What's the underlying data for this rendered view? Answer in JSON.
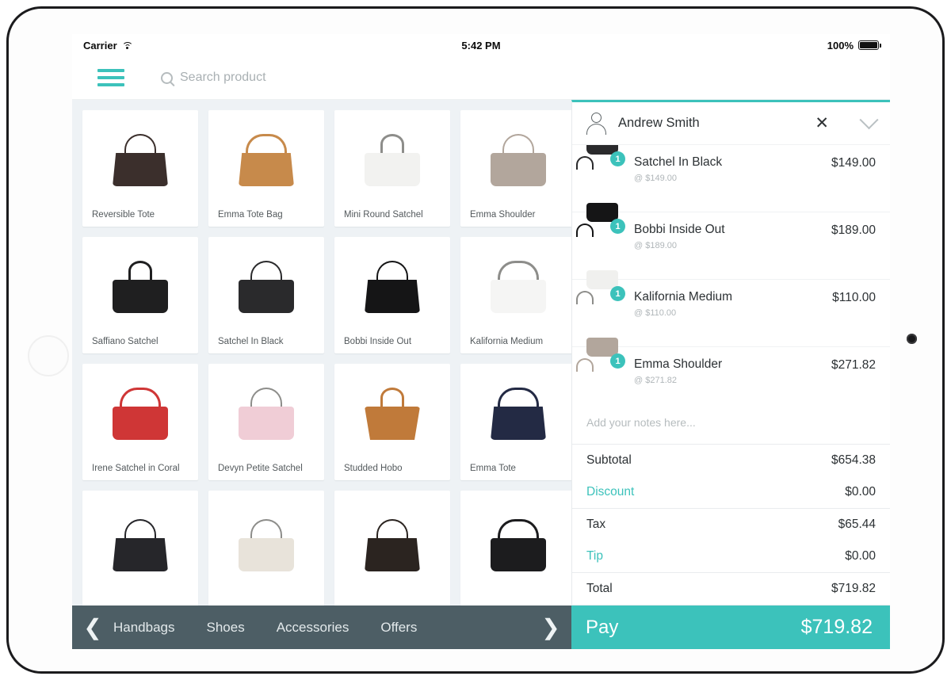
{
  "status_bar": {
    "carrier": "Carrier",
    "wifi_icon": "wifi-icon",
    "time": "5:42 PM",
    "battery_percent": "100%",
    "battery_icon": "battery-full-icon"
  },
  "search": {
    "menu_icon": "hamburger-menu-icon",
    "search_icon": "search-icon",
    "placeholder": "Search product",
    "value": ""
  },
  "colors": {
    "accent_teal": "#3cc2bb",
    "nav_dark": "#4d5e65",
    "grid_background": "#eef2f5",
    "text_primary": "#2c3134",
    "text_muted": "#b0b6b9"
  },
  "products": [
    {
      "name": "Reversible Tote",
      "color": "#3b2f2c",
      "style": "tote",
      "handle": "thin"
    },
    {
      "name": "Emma Tote Bag",
      "color": "#c78a4b",
      "style": "tote",
      "handle": "wide"
    },
    {
      "name": "Mini Round Satchel",
      "color": "#f2f2f0",
      "style": "satchel",
      "handle": "round"
    },
    {
      "name": "Emma Shoulder",
      "color": "#b2a69c",
      "style": "satchel",
      "handle": "thin"
    },
    {
      "name": "Saffiano Satchel",
      "color": "#1f1f20",
      "style": "satchel",
      "handle": "round"
    },
    {
      "name": "Satchel In Black",
      "color": "#2a2a2c",
      "style": "satchel",
      "handle": "thin"
    },
    {
      "name": "Bobbi Inside Out",
      "color": "#151516",
      "style": "tote",
      "handle": "thin"
    },
    {
      "name": "Kalifornia Medium",
      "color": "#f5f5f4",
      "style": "satchel",
      "handle": "wide"
    },
    {
      "name": "Irene Satchel in Coral",
      "color": "#cf3636",
      "style": "satchel",
      "handle": "wide"
    },
    {
      "name": "Devyn Petite Satchel",
      "color": "#f0cdd6",
      "style": "satchel",
      "handle": "thin"
    },
    {
      "name": "Studded Hobo",
      "color": "#c07a3a",
      "style": "hobo",
      "handle": "round"
    },
    {
      "name": "Emma Tote",
      "color": "#232a44",
      "style": "tote",
      "handle": "wide"
    },
    {
      "name": "",
      "color": "#26262a",
      "style": "tote",
      "handle": "thin"
    },
    {
      "name": "",
      "color": "#e8e3da",
      "style": "satchel",
      "handle": "thin"
    },
    {
      "name": "",
      "color": "#2b2420",
      "style": "tote",
      "handle": "thin"
    },
    {
      "name": "",
      "color": "#1c1c1e",
      "style": "satchel",
      "handle": "wide"
    }
  ],
  "cart": {
    "customer_icon": "person-avatar-icon",
    "customer_name": "Andrew Smith",
    "close_icon": "close-icon",
    "collapse_icon": "chevron-down-icon",
    "items": [
      {
        "name": "Satchel In Black",
        "qty": "1",
        "unit_price": "@ $149.00",
        "line_total": "$149.00",
        "color": "#2a2a2c"
      },
      {
        "name": "Bobbi Inside Out",
        "qty": "1",
        "unit_price": "@ $189.00",
        "line_total": "$189.00",
        "color": "#151516"
      },
      {
        "name": "Kalifornia Medium",
        "qty": "1",
        "unit_price": "@ $110.00",
        "line_total": "$110.00",
        "color": "#f0f0ee"
      },
      {
        "name": "Emma Shoulder",
        "qty": "1",
        "unit_price": "@ $271.82",
        "line_total": "$271.82",
        "color": "#b2a69c"
      }
    ],
    "notes_placeholder": "Add your notes here...",
    "notes_value": "",
    "totals": [
      {
        "label": "Subtotal",
        "value": "$654.38",
        "link": false
      },
      {
        "label": "Discount",
        "value": "$0.00",
        "link": true
      },
      {
        "label": "Tax",
        "value": "$65.44",
        "link": false
      },
      {
        "label": "Tip",
        "value": "$0.00",
        "link": true
      },
      {
        "label": "Total",
        "value": "$719.82",
        "link": false
      }
    ]
  },
  "category_nav": {
    "prev_icon": "chevron-left-icon",
    "next_icon": "chevron-right-icon",
    "categories": [
      "Handbags",
      "Shoes",
      "Accessories",
      "Offers"
    ]
  },
  "pay": {
    "label": "Pay",
    "amount": "$719.82"
  }
}
